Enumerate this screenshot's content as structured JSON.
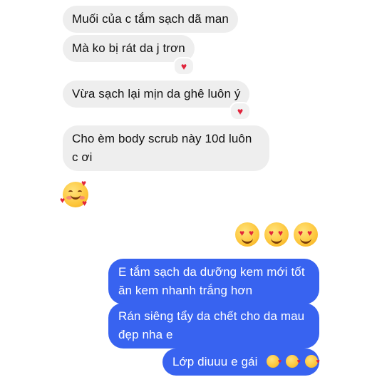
{
  "incoming": [
    {
      "text": "Muối của c tắm sạch dã man"
    },
    {
      "text": "Mà ko bị rát da j trơn",
      "reaction": "♥"
    },
    {
      "text": "Vừa sạch lại mịn da ghê luôn ý",
      "reaction": "♥"
    },
    {
      "text": "Cho èm body scrub này 10d luôn\nc ơi"
    }
  ],
  "outgoing": [
    {
      "text": "E tắm sạch da dưỡng kem mới tốt\năn kem nhanh trắng hơn"
    },
    {
      "text": "Rán siêng tẩy da chết cho da mau\nđẹp nha e"
    },
    {
      "text": "Lớp diuuu e gái"
    }
  ],
  "colors": {
    "incoming_bubble": "#eeeeee",
    "outgoing_bubble": "#3863f0",
    "reaction_heart": "#e0243b"
  },
  "emoji": {
    "incoming_reaction": "smiling-face-with-hearts",
    "outgoing_reaction": "heart-eyes-x3",
    "kisses": "face-blowing-kiss-x3"
  }
}
